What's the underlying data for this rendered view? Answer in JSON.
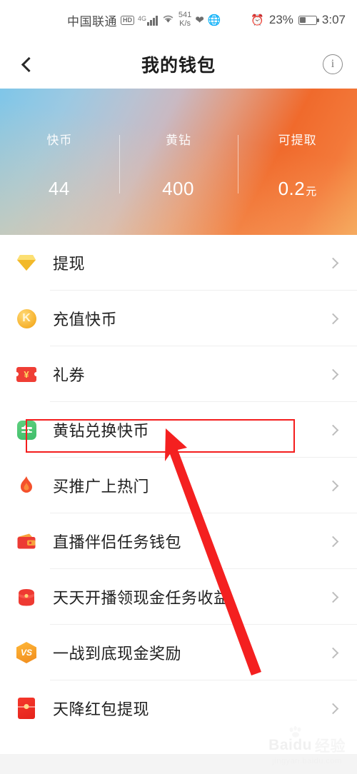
{
  "status_bar": {
    "carrier": "中国联通",
    "hd_badge": "HD",
    "network_type": "4G",
    "data_speed": "541",
    "data_speed_unit": "K/s",
    "heart_icon": "heart-icon",
    "globe_icon": "globe-icon",
    "alarm_icon": "alarm-clock-icon",
    "battery_percent": "23%",
    "clock": "3:07"
  },
  "header": {
    "back_icon": "chevron-left-icon",
    "title": "我的钱包",
    "info_icon": "info-circle-icon",
    "info_glyph": "i"
  },
  "banner": {
    "gradient_start": "#7fc6e8",
    "gradient_end": "#f06a2c",
    "stats": [
      {
        "label": "快币",
        "value": "44",
        "unit": ""
      },
      {
        "label": "黄钻",
        "value": "400",
        "unit": ""
      },
      {
        "label": "可提取",
        "value": "0.2",
        "unit": "元"
      }
    ]
  },
  "list": {
    "items": [
      {
        "label": "提现",
        "icon": "diamond-gem-icon",
        "chevron": "chevron-right-icon"
      },
      {
        "label": "充值快币",
        "icon": "k-coin-icon",
        "icon_text": "K",
        "chevron": "chevron-right-icon"
      },
      {
        "label": "礼券",
        "icon": "gift-ticket-icon",
        "icon_text": "¥",
        "chevron": "chevron-right-icon"
      },
      {
        "label": "黄钻兑换快币",
        "icon": "exchange-arrows-icon",
        "chevron": "chevron-right-icon"
      },
      {
        "label": "买推广上热门",
        "icon": "flame-icon",
        "chevron": "chevron-right-icon"
      },
      {
        "label": "直播伴侣任务钱包",
        "icon": "wallet-icon",
        "chevron": "chevron-right-icon"
      },
      {
        "label": "天天开播领现金任务收益",
        "icon": "money-pouch-icon",
        "chevron": "chevron-right-icon"
      },
      {
        "label": "一战到底现金奖励",
        "icon": "vs-badge-icon",
        "icon_text": "VS",
        "chevron": "chevron-right-icon"
      },
      {
        "label": "天降红包提现",
        "icon": "red-envelope-icon",
        "chevron": "chevron-right-icon"
      }
    ]
  },
  "annotation": {
    "highlight_color": "#f41d1d",
    "highlight_target": "黄钻兑换快币",
    "arrow_color": "#f42020"
  },
  "watermark": {
    "brand": "Baidu",
    "brand_cn": "经验",
    "url": "jingyan.baidu.com"
  }
}
